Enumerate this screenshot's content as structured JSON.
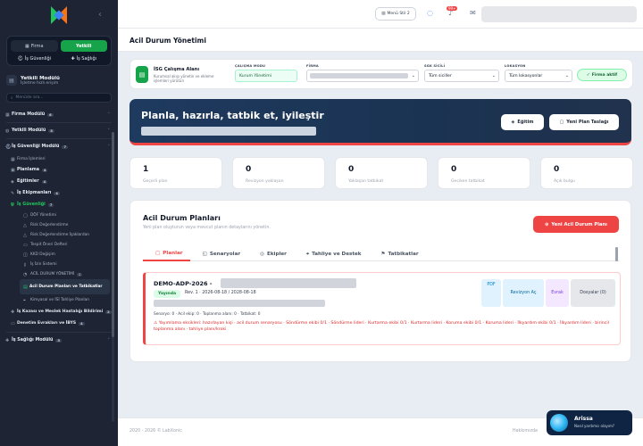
{
  "sidebar": {
    "role_tabs": [
      "Firma",
      "Yetkili"
    ],
    "role_subs": [
      "İş Güvenliği",
      "İş Sağlığı"
    ],
    "module_title": "Yetkili Modülü",
    "module_sub": "İşletme hızlı erişim",
    "search_placeholder": "Menüde ara...",
    "items": [
      {
        "label": "Firma Modülü",
        "badge": "6"
      },
      {
        "label": "Yetkili Modülü",
        "badge": "5"
      },
      {
        "label": "İş Güvenliği Modülü",
        "badge": "7"
      },
      {
        "label": "Firma İşlemleri"
      },
      {
        "label": "Planlama",
        "badge": "4"
      },
      {
        "label": "Eğitimler",
        "badge": "4"
      },
      {
        "label": "İş Ekipmanları",
        "badge": "4"
      },
      {
        "label": "İş Güvenliği",
        "badge": "7"
      },
      {
        "label": "DÖF Yönetimi"
      },
      {
        "label": "Risk Değerlendirme"
      },
      {
        "label": "Risk Değerlendirme İşaklardan"
      },
      {
        "label": "Tespit Öneri Defteri"
      },
      {
        "label": "KKD Değişim"
      },
      {
        "label": "İş İzin Sistemi"
      },
      {
        "label": "ACİL DURUM YÖNETİMİ",
        "badge": "2"
      },
      {
        "label": "Acil Durum Planları ve Tatbikatlar"
      },
      {
        "label": "Kimyasal ve İSİ Tahliye Planları"
      },
      {
        "label": "İş Kazası ve Meslek Hastalığı Bildirimi",
        "badge": "2"
      },
      {
        "label": "Denetim Evrakları ve İBYS",
        "badge": "4"
      },
      {
        "label": "İş Sağlığı Modülü",
        "badge": "5"
      }
    ]
  },
  "header": {
    "menu_button": "Menü Stil 2",
    "notif_count": "99+"
  },
  "page": {
    "title": "Acil Durum Yönetimi"
  },
  "context": {
    "title": "İSG Çalışma Alanı",
    "subtitle": "Kurumsal akışı yönetin ve ekleme işlemleri yürütün",
    "mode_label": "ÇALIŞMA MODU",
    "mode_value": "Kurum Yönetimi",
    "firm_label": "FİRMA",
    "sgk_label": "SGK SİCİLİ",
    "sgk_value": "Tüm siciller",
    "loc_label": "LOKASYON",
    "loc_value": "Tüm lokasyonlar",
    "firm_active": "Firma aktif"
  },
  "hero": {
    "title": "Planla, hazırla, tatbik et, iyileştir",
    "btn_training": "Eğitim",
    "btn_draft": "Yeni Plan Taslağı"
  },
  "stats": [
    {
      "value": "1",
      "label": "Geçerli plan"
    },
    {
      "value": "0",
      "label": "Revizyon yaklaşan"
    },
    {
      "value": "0",
      "label": "Yaklaşan tatbikat"
    },
    {
      "value": "0",
      "label": "Geciken tatbikat"
    },
    {
      "value": "0",
      "label": "Açık bulgu"
    }
  ],
  "plans": {
    "title": "Acil Durum Planları",
    "subtitle": "Yeni plan oluşturun veya mevcut planın detaylarını yönetin.",
    "new_button": "Yeni Acil Durum Planı",
    "tabs": [
      "Planlar",
      "Senaryolar",
      "Ekipler",
      "Tahliye ve Destek",
      "Tatbikatlar"
    ]
  },
  "plan": {
    "code": "DEMO-ADP-2026 -",
    "status": "Yayında",
    "version": "Rev. 1 · 2026-08-18 / 2028-08-18",
    "meta": "Senaryo: 0 · Acil ekip: 0 · Toplanma alanı: 0 · Tatbikat: 0",
    "warning": "Yayımlama eksikleri: hazırlayan kişi · acil durum senaryosu · Söndürme ekibi 0/1 · Söndürme lideri · Kurtarma ekibi 0/1 · Kurtarma lideri · Koruma ekibi 0/1 · Koruma lideri · İlkyardım ekibi 0/1 · İlkyardım lideri · birincil toplanma alanı · tahliye planı/kroki",
    "btn_pdf": "PDF",
    "btn_revision": "Revizyon Aç",
    "btn_docs": "Evrak",
    "btn_files": "Dosyalar (0)"
  },
  "footer": {
    "left": "2020 - 2026 © LabXonic",
    "right": "Hakkımızda"
  },
  "assistant": {
    "name": "Arissa",
    "sub": "Nasıl yardımcı olayım?"
  }
}
